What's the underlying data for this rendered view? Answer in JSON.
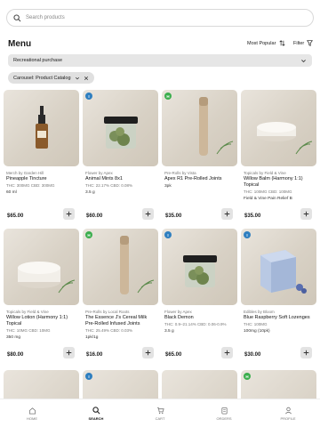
{
  "search": {
    "placeholder": "Search products",
    "icon": "search-icon"
  },
  "header": {
    "title": "Menu",
    "sort_label": "Most Popular",
    "filter_label": "Filter"
  },
  "purchase_type": {
    "selected": "Recreational purchase"
  },
  "active_filter": {
    "label": "Carousel: Product Catalog"
  },
  "products": [
    {
      "badge": "",
      "brand": "Merch by Garden Hill",
      "name": "Pineapple Tincture",
      "thc": "THC: 300MG CBD: 300MG",
      "size": "60 ml",
      "price": "$65.00",
      "image": "tincture-bottle"
    },
    {
      "badge": "I",
      "brand": "Flower by Apex",
      "name": "Animal Mints 8x1",
      "thc": "THC: 22.17% CBD: 0.08%",
      "size": "3.5 g",
      "price": "$60.00",
      "image": "flower-jar"
    },
    {
      "badge": "H",
      "brand": "Pre-Rolls by Vista",
      "name": "Apex R1 Pre-Rolled Joints",
      "thc": "",
      "size": "3pk",
      "price": "$35.00",
      "image": "pre-roll-tube"
    },
    {
      "badge": "",
      "brand": "Topicals by Field & Vine",
      "name": "Willow Balm (Harmony 1:1) Topical",
      "thc": "THC: 100MG CBD: 100MG",
      "size": "Field & Vine Pain Relief B",
      "price": "$35.00",
      "image": "balm-tin"
    },
    {
      "badge": "",
      "brand": "Topicals by Field & Vine",
      "name": "Willow Lotion (Harmony 1:1) Topical",
      "thc": "THC: 10MG CBD: 10MG",
      "size": "350 mg",
      "price": "$80.00",
      "image": "lotion-tin"
    },
    {
      "badge": "H",
      "brand": "Pre-Rolls by Local Roots",
      "name": "The Essence J's Cereal Milk Pre-Rolled Infused Joints",
      "thc": "THC: 25.49% CBD: 0.03%",
      "size": "1pk/1g",
      "price": "$16.00",
      "image": "pre-roll-tube"
    },
    {
      "badge": "I",
      "brand": "Flower by Apex",
      "name": "Black Demon",
      "thc": "THC: 0.9–21.14% CBD: 0.06-0.9%",
      "size": "3.5 g",
      "price": "$65.00",
      "image": "flower-jar"
    },
    {
      "badge": "I",
      "brand": "Edibles by Bloom",
      "name": "Blue Raspberry Soft Lozenges",
      "thc": "THC: 100MG",
      "size": "100mg (10pk)",
      "price": "$30.00",
      "image": "edible-box"
    }
  ],
  "peek_badges": [
    "",
    "I",
    "",
    "H"
  ],
  "tabs": [
    {
      "label": "HOME",
      "icon": "home-icon",
      "active": false
    },
    {
      "label": "SEARCH",
      "icon": "search-icon",
      "active": true
    },
    {
      "label": "CART",
      "icon": "cart-icon",
      "active": false
    },
    {
      "label": "ORDERS",
      "icon": "orders-icon",
      "active": false
    },
    {
      "label": "PROFILE",
      "icon": "profile-icon",
      "active": false
    }
  ],
  "colors": {
    "indica": "#2f7fc0",
    "hybrid": "#3cae4e",
    "chip": "#e0e0e0",
    "select": "#e6e6e6"
  }
}
